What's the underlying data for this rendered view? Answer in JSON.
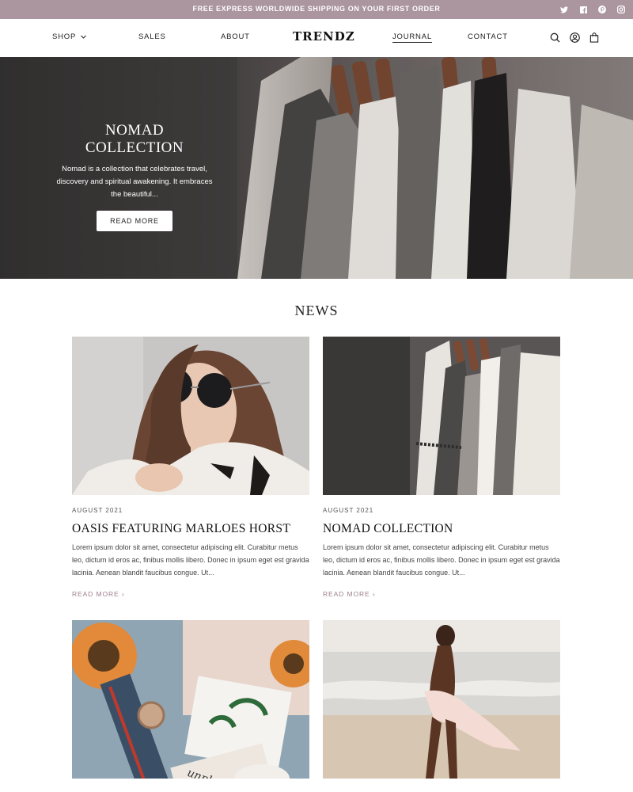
{
  "announcement": "FREE EXPRESS WORLDWIDE SHIPPING ON YOUR FIRST ORDER",
  "social": [
    "twitter-icon",
    "facebook-icon",
    "pinterest-icon",
    "instagram-icon"
  ],
  "nav": {
    "shop": "SHOP",
    "sales": "SALES",
    "about": "ABOUT",
    "journal": "JOURNAL",
    "contact": "CONTACT"
  },
  "logo": "TRENDZ",
  "header_icons": [
    "search-icon",
    "account-icon",
    "bag-icon"
  ],
  "hero": {
    "title": "NOMAD COLLECTION",
    "description": "Nomad is a collection that celebrates travel, discovery and spiritual awakening. It embraces the beautiful...",
    "button": "READ MORE"
  },
  "news": {
    "heading": "NEWS",
    "posts": [
      {
        "date": "AUGUST 2021",
        "title": "OASIS FEATURING MARLOES HORST",
        "excerpt": "Lorem ipsum dolor sit amet, consectetur adipiscing elit. Curabitur metus leo, dictum id eros ac, finibus mollis libero. Donec in ipsum eget est gravida lacinia. Aenean blandit faucibus congue. Ut...",
        "link": "READ MORE ›"
      },
      {
        "date": "AUGUST 2021",
        "title": "NOMAD COLLECTION",
        "excerpt": "Lorem ipsum dolor sit amet, consectetur adipiscing elit. Curabitur metus leo, dictum id eros ac, finibus mollis libero. Donec in ipsum eget est gravida lacinia. Aenean blandit faucibus congue. Ut...",
        "link": "READ MORE ›"
      }
    ]
  },
  "colors": {
    "topbar": "#ab959f",
    "accent": "#9e7f8d"
  }
}
